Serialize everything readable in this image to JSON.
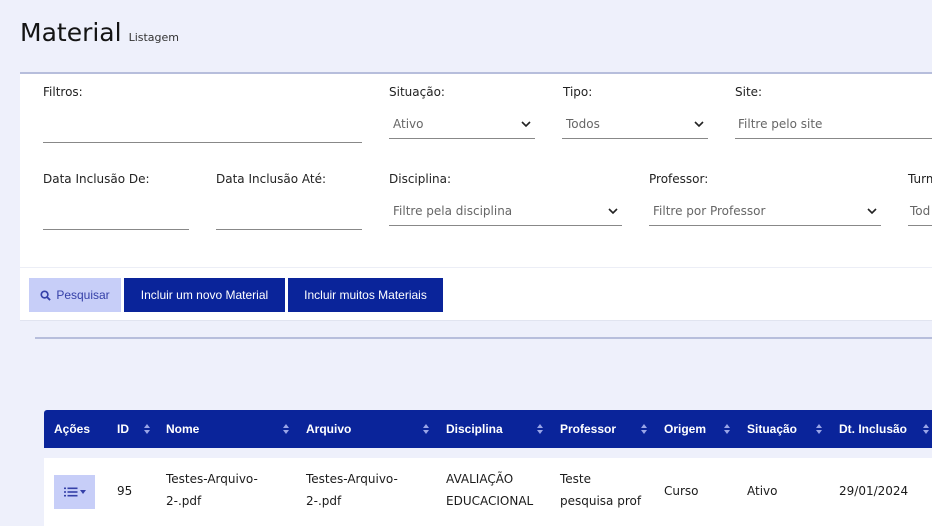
{
  "page": {
    "title": "Material",
    "subtitle": "Listagem"
  },
  "filters": {
    "filtros_label": "Filtros:",
    "situacao_label": "Situação:",
    "situacao_value": "Ativo",
    "tipo_label": "Tipo:",
    "tipo_value": "Todos",
    "site_label": "Site:",
    "site_placeholder": "Filtre pelo site",
    "data_de_label": "Data Inclusão De:",
    "data_ate_label": "Data Inclusão Até:",
    "disciplina_label": "Disciplina:",
    "disciplina_placeholder": "Filtre pela disciplina",
    "professor_label": "Professor:",
    "professor_placeholder": "Filtre por Professor",
    "turma_label": "Turm",
    "turma_placeholder": "Tod"
  },
  "buttons": {
    "pesquisar": "Pesquisar",
    "incluir_novo": "Incluir um novo Material",
    "incluir_muitos": "Incluir muitos Materiais"
  },
  "table": {
    "columns": [
      "Ações",
      "ID",
      "Nome",
      "Arquivo",
      "Disciplina",
      "Professor",
      "Origem",
      "Situação",
      "Dt. Inclusão"
    ],
    "rows": [
      {
        "id": "95",
        "nome_1": "Testes-Arquivo-",
        "nome_2": "2-.pdf",
        "arquivo_1": "Testes-Arquivo-",
        "arquivo_2": "2-.pdf",
        "disciplina_1": "AVALIAÇÃO",
        "disciplina_2": "EDUCACIONAL",
        "professor_1": "Teste",
        "professor_2": "pesquisa prof",
        "origem": "Curso",
        "situacao": "Ativo",
        "dt_inclusao": "29/01/2024"
      }
    ]
  },
  "colors": {
    "primary": "#0a249a",
    "light_button": "#c7cef8",
    "background": "#eef0fb"
  },
  "icons": {
    "search": "search-icon",
    "chevron": "chevron-down-icon",
    "sort": "sort-icon",
    "actions": "list-actions-icon"
  }
}
